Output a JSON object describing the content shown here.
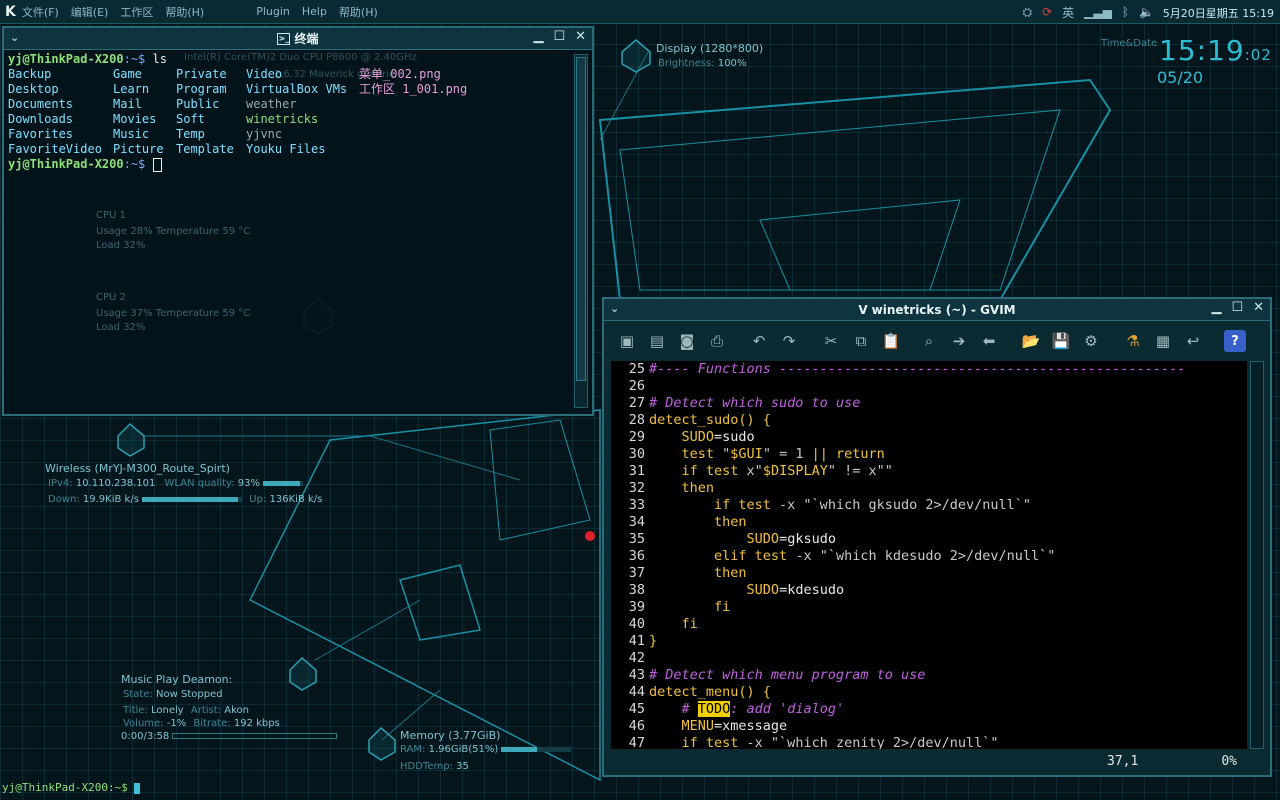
{
  "top_panel": {
    "menus": [
      "文件(F)",
      "编辑(E)",
      "工作区",
      "帮助(H)"
    ],
    "extra_menus": [
      "Plugin",
      "Help",
      "帮助(H)"
    ],
    "tray_icons": [
      "network-icon",
      "refresh-icon",
      "input-method-icon",
      "signal-icon",
      "bluetooth-icon",
      "volume-icon"
    ],
    "input_method": "英",
    "clock": "5月20日星期五 15:19"
  },
  "conky": {
    "time_label": "Time&Date",
    "time": "15:19",
    "seconds": ":02",
    "date": "05/20",
    "display": {
      "label": "Display (1280*800)",
      "brightness_label": "Brightness:",
      "brightness": "100%"
    },
    "cpu_model": "Intel(R) Core(TM)2 Duo CPU     P8600 @ 2.40GHz",
    "kernel": "2.6.32 Maverick generic",
    "cpu1": {
      "title": "CPU 1",
      "usage_label": "Usage",
      "usage": "28%",
      "temp_label": "Temperature",
      "temp": "59 °C",
      "load_label": "Load",
      "load": "32%"
    },
    "cpu2": {
      "title": "CPU 2",
      "usage_label": "Usage",
      "usage": "37%",
      "temp_label": "Temperature",
      "temp": "59 °C",
      "load_label": "Load",
      "load": "32%"
    },
    "wireless": {
      "title": "Wireless (MrYJ-M300_Route_Spirt)",
      "ip_label": "IPv4:",
      "ip": "10.110.238.101",
      "quality_label": "WLAN quality:",
      "quality": "93%",
      "down_label": "Down:",
      "down": "19.9KiB k/s",
      "up_label": "Up:",
      "up": "136KiB k/s"
    },
    "music": {
      "title": "Music Play Deamon:",
      "state_label": "State:",
      "state": "Now Stopped",
      "title_label": "Title:",
      "song": "Lonely",
      "artist_label": "Artist:",
      "artist": "Akon",
      "volume_label": "Volume:",
      "volume": "-1%",
      "bitrate_label": "Bitrate:",
      "bitrate": "192 kbps",
      "progress": "0:00/3:58"
    },
    "memory": {
      "title": "Memory (3.77GiB)",
      "ram_label": "RAM:",
      "ram": "1.96GiB(51%)",
      "hdd_label": "HDDTemp:",
      "hdd": "35"
    }
  },
  "terminal": {
    "title": "终端",
    "prompt_user": "yj@ThinkPad-X200",
    "prompt_path": ":~$",
    "command": "ls",
    "ls_rows": [
      [
        {
          "t": "Backup",
          "c": "dir"
        },
        {
          "t": "Game",
          "c": "dir"
        },
        {
          "t": "Private",
          "c": "dir"
        },
        {
          "t": "Video",
          "c": "dir"
        },
        {
          "t": "菜单_002.png",
          "c": "img"
        }
      ],
      [
        {
          "t": "Desktop",
          "c": "dir"
        },
        {
          "t": "Learn",
          "c": "dir"
        },
        {
          "t": "Program",
          "c": "dir"
        },
        {
          "t": "VirtualBox VMs",
          "c": "dir"
        },
        {
          "t": "工作区 1_001.png",
          "c": "img"
        }
      ],
      [
        {
          "t": "Documents",
          "c": "dir"
        },
        {
          "t": "Mail",
          "c": "dir"
        },
        {
          "t": "Public",
          "c": "dir"
        },
        {
          "t": "weather",
          "c": "file"
        },
        {
          "t": "",
          "c": "file"
        }
      ],
      [
        {
          "t": "Downloads",
          "c": "dir"
        },
        {
          "t": "Movies",
          "c": "dir"
        },
        {
          "t": "Soft",
          "c": "dir"
        },
        {
          "t": "winetricks",
          "c": "exe"
        },
        {
          "t": "",
          "c": "file"
        }
      ],
      [
        {
          "t": "Favorites",
          "c": "dir"
        },
        {
          "t": "Music",
          "c": "dir"
        },
        {
          "t": "Temp",
          "c": "dir"
        },
        {
          "t": "yjvnc",
          "c": "file"
        },
        {
          "t": "",
          "c": "file"
        }
      ],
      [
        {
          "t": "FavoriteVideo",
          "c": "dir"
        },
        {
          "t": "Picture",
          "c": "dir"
        },
        {
          "t": "Template",
          "c": "dir"
        },
        {
          "t": "Youku Files",
          "c": "dir"
        },
        {
          "t": "",
          "c": "file"
        }
      ]
    ]
  },
  "gvim": {
    "title": "winetricks (~) - GVIM",
    "toolbar": [
      "open-icon",
      "save-all-icon",
      "save-icon",
      "print-icon",
      "undo-icon",
      "redo-icon",
      "cut-icon",
      "copy-icon",
      "paste-icon",
      "find-icon",
      "find-next-icon",
      "find-prev-icon",
      "load-session-icon",
      "save-session-icon",
      "run-make-icon",
      "run-ctags-icon",
      "table-icon",
      "jump-tag-icon",
      "help-icon"
    ],
    "help_label": "?",
    "lines": [
      {
        "n": "25",
        "p": [
          {
            "t": "#---- Functions --------------------------------------------------",
            "c": "cm"
          }
        ]
      },
      {
        "n": "26",
        "p": []
      },
      {
        "n": "27",
        "p": [
          {
            "t": "# Detect which sudo to use",
            "c": "cm"
          }
        ]
      },
      {
        "n": "28",
        "p": [
          {
            "t": "detect_sudo() {",
            "c": "k"
          }
        ]
      },
      {
        "n": "29",
        "p": [
          {
            "t": "    ",
            "c": "code"
          },
          {
            "t": "SUDO",
            "c": "v"
          },
          {
            "t": "=sudo",
            "c": "code"
          }
        ]
      },
      {
        "n": "30",
        "p": [
          {
            "t": "    ",
            "c": "code"
          },
          {
            "t": "test ",
            "c": "k"
          },
          {
            "t": "\"",
            "c": "s"
          },
          {
            "t": "$GUI",
            "c": "v"
          },
          {
            "t": "\" = 1 ",
            "c": "s"
          },
          {
            "t": "|| return",
            "c": "k"
          }
        ]
      },
      {
        "n": "31",
        "p": [
          {
            "t": "    ",
            "c": "code"
          },
          {
            "t": "if test ",
            "c": "k"
          },
          {
            "t": "x\"",
            "c": "s"
          },
          {
            "t": "$DISPLAY",
            "c": "v"
          },
          {
            "t": "\" != x\"\"",
            "c": "s"
          }
        ]
      },
      {
        "n": "32",
        "p": [
          {
            "t": "    then",
            "c": "k"
          }
        ]
      },
      {
        "n": "33",
        "p": [
          {
            "t": "        if test ",
            "c": "k"
          },
          {
            "t": "-x \"`which gksudo 2>/dev/null`\"",
            "c": "s"
          }
        ]
      },
      {
        "n": "34",
        "p": [
          {
            "t": "        then",
            "c": "k"
          }
        ]
      },
      {
        "n": "35",
        "p": [
          {
            "t": "            ",
            "c": "code"
          },
          {
            "t": "SUDO",
            "c": "v"
          },
          {
            "t": "=gksudo",
            "c": "code"
          }
        ]
      },
      {
        "n": "36",
        "p": [
          {
            "t": "        elif test ",
            "c": "k"
          },
          {
            "t": "-x \"`which kdesudo 2>/dev/null`\"",
            "c": "s"
          }
        ]
      },
      {
        "n": "37",
        "p": [
          {
            "t": "        then",
            "c": "k"
          }
        ]
      },
      {
        "n": "38",
        "p": [
          {
            "t": "            ",
            "c": "code"
          },
          {
            "t": "SUDO",
            "c": "v"
          },
          {
            "t": "=kdesudo",
            "c": "code"
          }
        ]
      },
      {
        "n": "39",
        "p": [
          {
            "t": "        fi",
            "c": "k"
          }
        ]
      },
      {
        "n": "40",
        "p": [
          {
            "t": "    fi",
            "c": "k"
          }
        ]
      },
      {
        "n": "41",
        "p": [
          {
            "t": "}",
            "c": "k"
          }
        ]
      },
      {
        "n": "42",
        "p": []
      },
      {
        "n": "43",
        "p": [
          {
            "t": "# Detect which menu program to use",
            "c": "cm"
          }
        ]
      },
      {
        "n": "44",
        "p": [
          {
            "t": "detect_menu() {",
            "c": "k"
          }
        ]
      },
      {
        "n": "45",
        "p": [
          {
            "t": "    ",
            "c": "code"
          },
          {
            "t": "# ",
            "c": "cm"
          },
          {
            "t": "TODO",
            "c": "todo"
          },
          {
            "t": ": add 'dialog'",
            "c": "cm"
          }
        ]
      },
      {
        "n": "46",
        "p": [
          {
            "t": "    ",
            "c": "code"
          },
          {
            "t": "MENU",
            "c": "v"
          },
          {
            "t": "=xmessage",
            "c": "code"
          }
        ]
      },
      {
        "n": "47",
        "p": [
          {
            "t": "    ",
            "c": "code"
          },
          {
            "t": "if test ",
            "c": "k"
          },
          {
            "t": "-x \"`which zenity 2>/dev/null`\"",
            "c": "s"
          }
        ]
      }
    ],
    "status_pos": "37,1",
    "status_pct": "0%"
  },
  "bottom_prompt": "yj@ThinkPad-X200:~$"
}
